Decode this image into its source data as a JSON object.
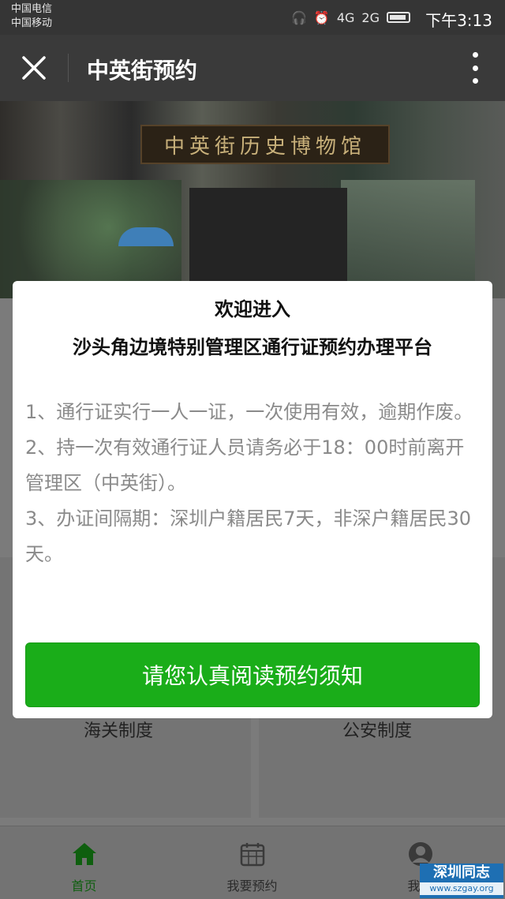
{
  "status_bar": {
    "carrier1": "中国电信",
    "carrier2": "中国移动",
    "network1": "4G",
    "network2": "2G",
    "time": "下午3:13"
  },
  "title_bar": {
    "title": "中英街预约"
  },
  "banner": {
    "sign_text": "中英街历史博物馆"
  },
  "background_page": {
    "card_left_label": "海关制度",
    "card_right_label": "公安制度"
  },
  "modal": {
    "heading_line1": "欢迎进入",
    "heading_line2": "沙头角边境特别管理区通行证预约办理平台",
    "notices": [
      "1、通行证实行一人一证，一次使用有效，逾期作废。",
      "2、持一次有效通行证人员请务必于18：00时前离开管理区（中英街）。",
      "3、办证间隔期：深圳户籍居民7天，非深户籍居民30天。"
    ],
    "button_label": "请您认真阅读预约须知"
  },
  "tab_bar": {
    "tabs": [
      {
        "label": "首页",
        "icon": "home-icon",
        "active": true
      },
      {
        "label": "我要预约",
        "icon": "calendar-icon",
        "active": false
      },
      {
        "label": "我的",
        "icon": "user-icon",
        "active": false
      }
    ]
  },
  "watermark": {
    "line1": "深圳同志",
    "line2": "www.szgay.org"
  },
  "colors": {
    "primary_green": "#1aad19",
    "title_bar": "#3a3a3a",
    "status_bar": "#353535"
  }
}
